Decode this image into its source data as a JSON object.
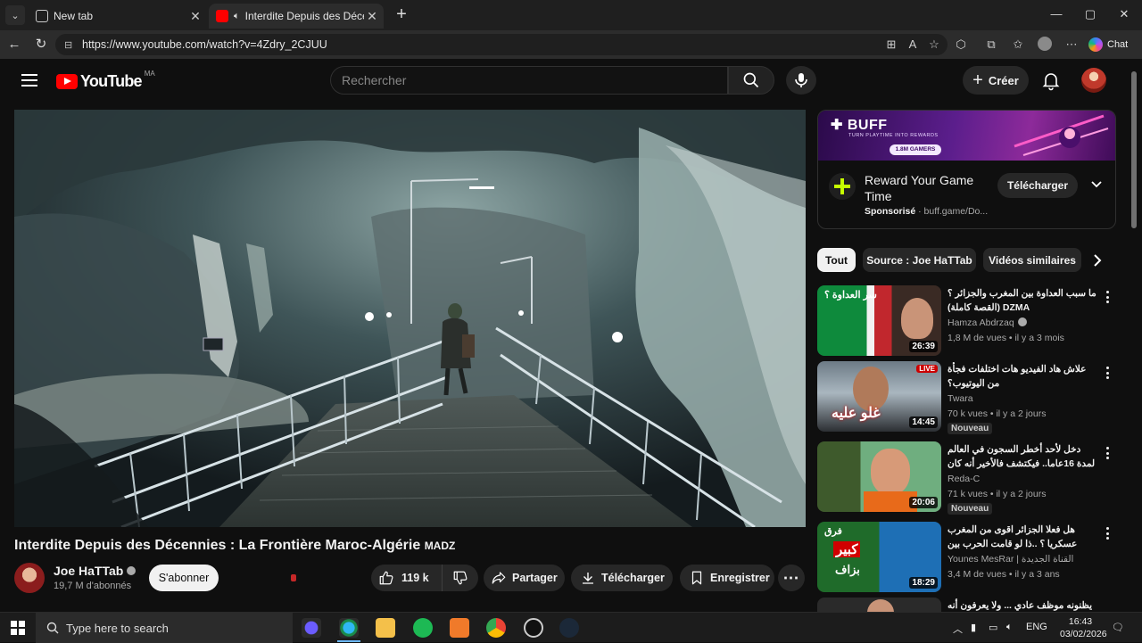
{
  "browser": {
    "tabs": [
      {
        "label": "New tab"
      },
      {
        "label": "Interdite Depuis des Décennie"
      }
    ],
    "url": "https://www.youtube.com/watch?v=4Zdry_2CJUU",
    "chat_label": "Chat"
  },
  "header": {
    "logo_text": "YouTube",
    "country_code": "MA",
    "search_placeholder": "Rechercher",
    "create_label": "Créer"
  },
  "video": {
    "title": "Interdite Depuis des Décennies : La Frontière Maroc-Algérie",
    "title_suffix": "MADZ",
    "channel": "Joe HaTTab",
    "subscribers": "19,7 M d'abonnés",
    "subscribe_label": "S'abonner",
    "likes": "119 k",
    "share_label": "Partager",
    "download_label": "Télécharger",
    "save_label": "Enregistrer"
  },
  "ad": {
    "brand": "BUFF",
    "tagline": "TURN PLAYTIME INTO REWARDS",
    "gamers": "1.8M GAMERS",
    "title": "Reward Your Game Time",
    "sponsored": "Sponsorisé",
    "domain": "buff.game/Do...",
    "cta": "Télécharger"
  },
  "chips": [
    {
      "label": "Tout"
    },
    {
      "label": "Source : Joe HaTTab"
    },
    {
      "label": "Vidéos similaires"
    }
  ],
  "recommendations": [
    {
      "title": "ما سبب العداوة بين المغرب والجزائر ؟ DZMA (القصة كاملة)",
      "channel": "Hamza Abdrzaq",
      "meta": "1,8 M de vues • il y a 3 mois",
      "duration": "26:39",
      "badge": ""
    },
    {
      "title": "علاش هاد الفيديو هات اختلفات فجأة من اليوتيوب؟",
      "channel": "Twara",
      "meta": "70 k vues • il y a 2 jours",
      "duration": "14:45",
      "badge": "Nouveau",
      "live": "LIVE"
    },
    {
      "title": "دخل لأحد أخطر السجون في العالم لمدة 16عاما.. فيكتشف فالأخير أنه كان مظلوما",
      "channel": "Reda-C",
      "meta": "71 k vues • il y a 2 jours",
      "duration": "20:06",
      "badge": "Nouveau"
    },
    {
      "title": "هل فعلا الجزائر اقوى من المغرب عسكريا ؟ ..ذا لو قامت الحرب بين المغرب و الجزائر ؟",
      "channel": "Younes MesRar | القناة الجديدة",
      "meta": "3,4 M de vues • il y a 3 ans",
      "duration": "18:29",
      "badge": ""
    },
    {
      "title": "يظنونه موظف عادي ... ولا يعرفون أنه",
      "channel": "",
      "meta": "",
      "duration": "",
      "badge": ""
    }
  ],
  "thumb_texts": {
    "t1": "سر العداوة ؟",
    "t2": "غلو عليه",
    "t4a": "فرق",
    "t4b": "كبير",
    "t4c": "بزاف"
  },
  "taskbar": {
    "search_placeholder": "Type here to search",
    "language": "ENG",
    "time": "16:43",
    "date": "03/02/2026"
  }
}
